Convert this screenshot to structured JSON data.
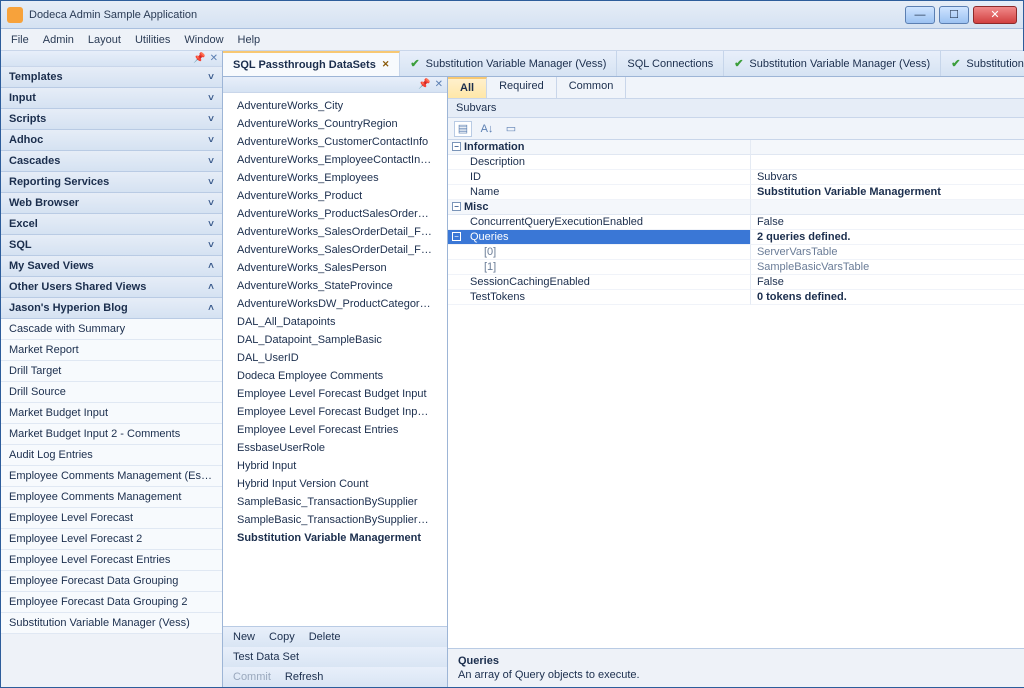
{
  "window": {
    "title": "Dodeca Admin Sample Application"
  },
  "menu": [
    "File",
    "Admin",
    "Layout",
    "Utilities",
    "Window",
    "Help"
  ],
  "sidebar_sections": [
    {
      "label": "Templates",
      "chev": "˅"
    },
    {
      "label": "Input",
      "chev": "˅"
    },
    {
      "label": "Scripts",
      "chev": "˅"
    },
    {
      "label": "Adhoc",
      "chev": "˅"
    },
    {
      "label": "Cascades",
      "chev": "˅"
    },
    {
      "label": "Reporting Services",
      "chev": "˅"
    },
    {
      "label": "Web Browser",
      "chev": "˅"
    },
    {
      "label": "Excel",
      "chev": "˅"
    },
    {
      "label": "SQL",
      "chev": "˅"
    },
    {
      "label": "My Saved Views",
      "chev": "˄"
    },
    {
      "label": "Other Users Shared Views",
      "chev": "˄"
    },
    {
      "label": "Jason's Hyperion Blog",
      "chev": "˄"
    }
  ],
  "blog_items": [
    "Cascade with Summary",
    "Market Report",
    "Drill Target",
    "Drill Source",
    "Market Budget Input",
    "Market Budget Input 2 - Comments",
    "Audit Log Entries",
    "Employee Comments Management (Essbase..",
    "Employee Comments Management",
    "Employee Level Forecast",
    "Employee Level Forecast 2",
    "Employee Level Forecast Entries",
    "Employee Forecast Data Grouping",
    "Employee Forecast Data Grouping 2",
    "Substitution Variable Manager (Vess)"
  ],
  "center_tab_active": "SQL Passthrough DataSets",
  "top_tabs": [
    {
      "label": "Substitution Variable Manager (Vess)",
      "check": true
    },
    {
      "label": "SQL Connections",
      "check": false
    },
    {
      "label": "Substitution Variable Manager (Vess)",
      "check": true
    },
    {
      "label": "Substitution",
      "check": true,
      "dd": true
    }
  ],
  "center_items": [
    "AdventureWorks_City",
    "AdventureWorks_CountryRegion",
    "AdventureWorks_CustomerContactInfo",
    "AdventureWorks_EmployeeContactInfo_U...",
    "AdventureWorks_Employees",
    "AdventureWorks_Product",
    "AdventureWorks_ProductSalesOrderDetail",
    "AdventureWorks_SalesOrderDetail_Filtere...",
    "AdventureWorks_SalesOrderDetail_Filtere...",
    "AdventureWorks_SalesPerson",
    "AdventureWorks_StateProvince",
    "AdventureWorksDW_ProductCategories",
    "DAL_All_Datapoints",
    "DAL_Datapoint_SampleBasic",
    "DAL_UserID",
    "Dodeca Employee Comments",
    "Employee Level Forecast Budget Input",
    "Employee Level Forecast Budget Input Ent...",
    "Employee Level Forecast Entries",
    "EssbaseUserRole",
    "Hybrid Input",
    "Hybrid Input Version Count",
    "SampleBasic_TransactionBySupplier",
    "SampleBasic_TransactionBySupplier_All"
  ],
  "center_selected": "Substitution Variable Managerment",
  "center_toolbar": {
    "row1": [
      "New",
      "Copy",
      "Delete"
    ],
    "row2": [
      "Test Data Set"
    ],
    "row3": [
      "Commit",
      "Refresh"
    ]
  },
  "filter_tabs": [
    "All",
    "Required",
    "Common"
  ],
  "breadcrumb": "Subvars",
  "prop_groups": {
    "information": {
      "header": "Information",
      "rows": [
        {
          "k": "Description",
          "v": ""
        },
        {
          "k": "ID",
          "v": "Subvars"
        },
        {
          "k": "Name",
          "v": "Substitution Variable Managerment",
          "bold": true
        }
      ]
    },
    "misc": {
      "header": "Misc",
      "rows": [
        {
          "k": "ConcurrentQueryExecutionEnabled",
          "v": "False"
        },
        {
          "k": "Queries",
          "v": "2 queries defined.",
          "sel": true
        },
        {
          "k": "[0]",
          "v": "ServerVarsTable",
          "indent": true
        },
        {
          "k": "[1]",
          "v": "SampleBasicVarsTable",
          "indent": true
        },
        {
          "k": "SessionCachingEnabled",
          "v": "False"
        },
        {
          "k": "TestTokens",
          "v": "0 tokens defined.",
          "bold": true
        }
      ]
    }
  },
  "desc": {
    "title": "Queries",
    "text": "An array of Query objects to execute."
  }
}
